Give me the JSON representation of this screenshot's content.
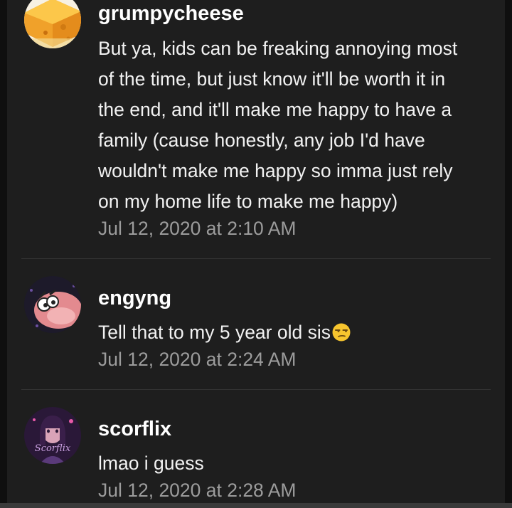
{
  "comments": [
    {
      "username": "grumpycheese",
      "avatar_icon": "cheese-avatar-icon",
      "body_lines": [
        "But ya, kids can be freaking annoying most",
        "of the time, but just know it'll be worth it in",
        "the end, and it'll make me happy to have a",
        "family (cause honestly, any job I'd have",
        "wouldn't make me happy so imma just rely",
        "on my home life to make me happy)"
      ],
      "timestamp": "Jul 12, 2020 at 2:10 AM"
    },
    {
      "username": "engyng",
      "avatar_icon": "cartoon-character-avatar-icon",
      "body": "Tell that to my 5 year old sis",
      "emoji": "unamused-face-emoji",
      "timestamp": "Jul 12, 2020 at 2:24 AM"
    },
    {
      "username": "scorflix",
      "avatar_icon": "girl-portrait-avatar-icon",
      "avatar_signature": "Scorflix",
      "body": "lmao i guess",
      "timestamp": "Jul 12, 2020 at 2:28 AM"
    }
  ],
  "colors": {
    "background": "#0f0f0f",
    "panel": "#1e1e1e",
    "username": "#ffffff",
    "body_text": "#f2f2f2",
    "timestamp": "#9c9c9c",
    "divider": "#333333"
  }
}
